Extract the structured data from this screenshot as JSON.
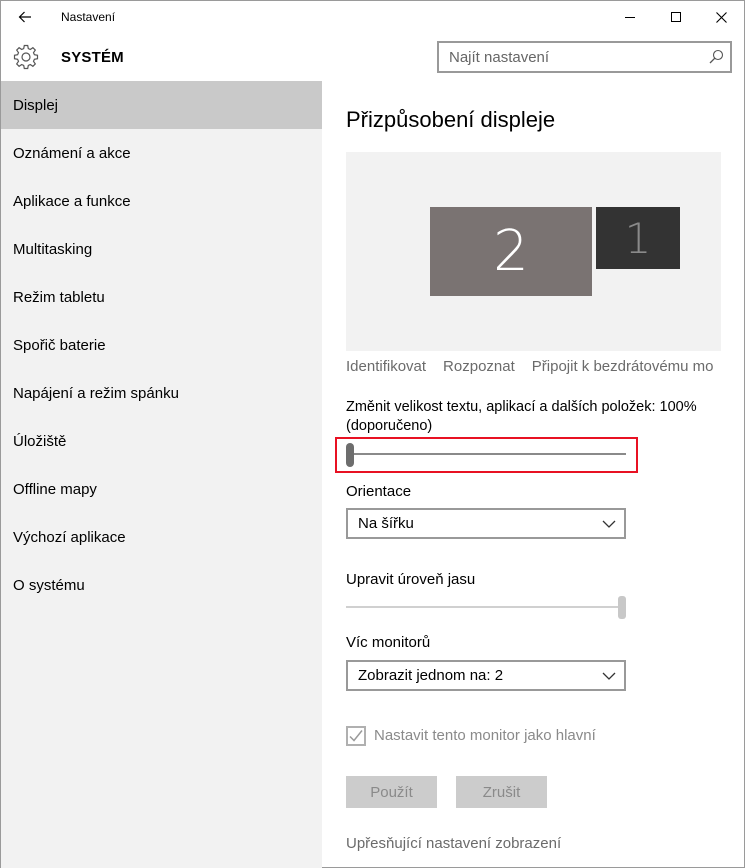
{
  "window": {
    "title": "Nastavení"
  },
  "header": {
    "section_title": "SYSTÉM",
    "search_placeholder": "Najít nastavení"
  },
  "sidebar": {
    "items": [
      {
        "label": "Displej",
        "active": true
      },
      {
        "label": "Oznámení a akce"
      },
      {
        "label": "Aplikace a funkce"
      },
      {
        "label": "Multitasking"
      },
      {
        "label": "Režim tabletu"
      },
      {
        "label": "Spořič baterie"
      },
      {
        "label": "Napájení a režim spánku"
      },
      {
        "label": "Úložiště"
      },
      {
        "label": "Offline mapy"
      },
      {
        "label": "Výchozí aplikace"
      },
      {
        "label": "O systému"
      }
    ]
  },
  "main": {
    "title": "Přizpůsobení displeje",
    "monitors": {
      "primary_label": "2",
      "secondary_label": "1"
    },
    "links": {
      "identify": "Identifikovat",
      "detect": "Rozpoznat",
      "connect_wireless": "Připojit k bezdrátovému mo"
    },
    "scale": {
      "label": "Změnit velikost textu, aplikací a dalších položek: 100% (doporučeno)",
      "value_percent": 100,
      "slider_fraction": 0.0
    },
    "orientation": {
      "label": "Orientace",
      "value": "Na šířku"
    },
    "brightness": {
      "label": "Upravit úroveň jasu",
      "slider_fraction": 1.0
    },
    "multiple_displays": {
      "label": "Víc monitorů",
      "value": "Zobrazit jednom na: 2"
    },
    "make_main": {
      "label": "Nastavit tento monitor jako hlavní",
      "checked": true,
      "disabled": true
    },
    "buttons": {
      "apply": "Použít",
      "cancel": "Zrušit"
    },
    "advanced_link": "Upřesňující nastavení zobrazení"
  },
  "colors": {
    "sidebar_bg": "#f2f2f2",
    "sidebar_active": "#c9c9c9",
    "highlight": "#e81123",
    "monitor_primary": "#7a7372",
    "monitor_secondary": "#333333"
  }
}
